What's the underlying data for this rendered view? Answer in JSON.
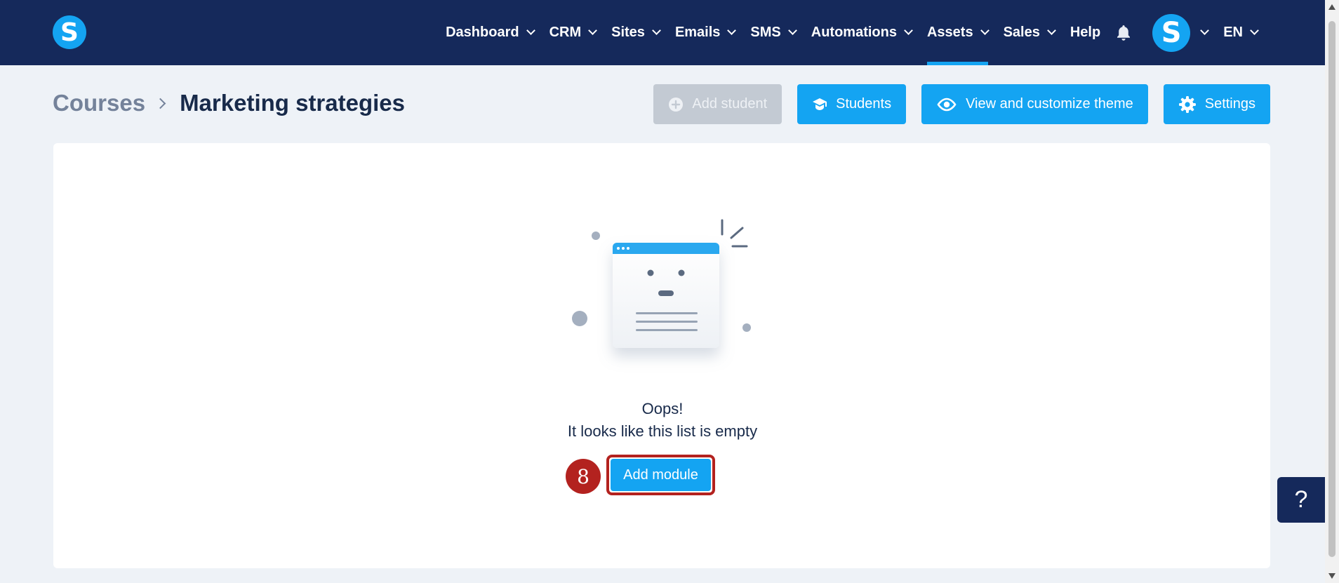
{
  "brand": {
    "logo_letter": "S",
    "accent": "#14a4f2",
    "navy": "#15295b"
  },
  "nav": {
    "items": [
      {
        "label": "Dashboard",
        "has_dropdown": true,
        "active": false
      },
      {
        "label": "CRM",
        "has_dropdown": true,
        "active": false
      },
      {
        "label": "Sites",
        "has_dropdown": true,
        "active": false
      },
      {
        "label": "Emails",
        "has_dropdown": true,
        "active": false
      },
      {
        "label": "SMS",
        "has_dropdown": true,
        "active": false
      },
      {
        "label": "Automations",
        "has_dropdown": true,
        "active": false
      },
      {
        "label": "Assets",
        "has_dropdown": true,
        "active": true
      },
      {
        "label": "Sales",
        "has_dropdown": true,
        "active": false
      },
      {
        "label": "Help",
        "has_dropdown": false,
        "active": false
      }
    ],
    "notifications_icon": "bell-icon",
    "avatar_letter": "S",
    "language": "EN"
  },
  "breadcrumb": {
    "parent": "Courses",
    "current": "Marketing strategies"
  },
  "actions": {
    "add_student": "Add student",
    "students": "Students",
    "view_theme": "View and customize theme",
    "settings": "Settings"
  },
  "empty_state": {
    "title": "Oops!",
    "message": "It looks like this list is empty",
    "button": "Add module"
  },
  "annotation": {
    "step": "8",
    "color": "#b3221f"
  },
  "help_fab": "?"
}
